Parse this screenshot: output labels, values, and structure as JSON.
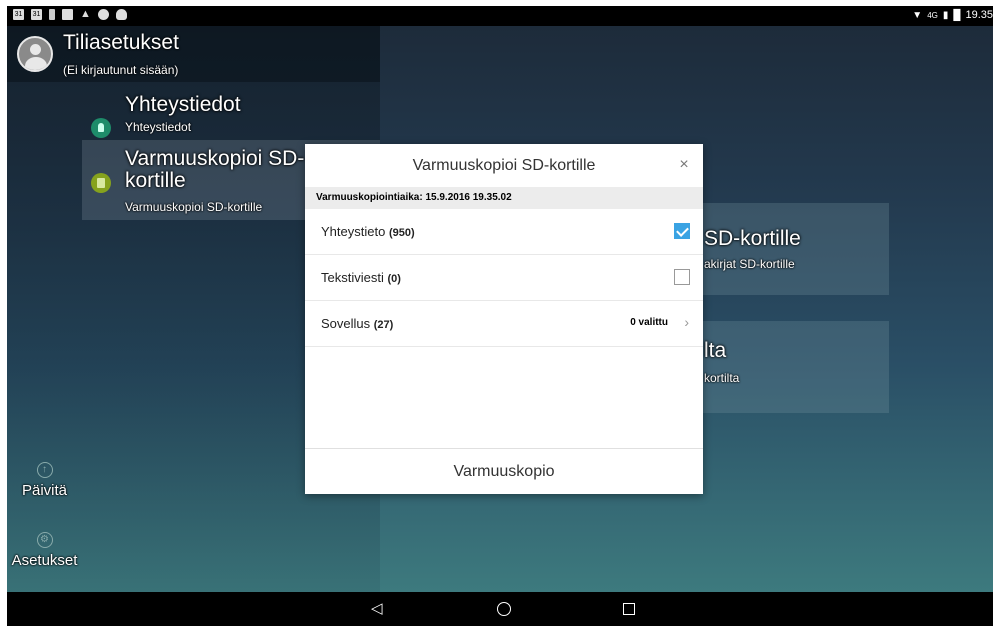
{
  "status_bar": {
    "time": "19.35",
    "network": "4G",
    "left_icons": [
      "calendar-icon",
      "calendar-icon",
      "notification-icon",
      "image-icon",
      "warning-icon",
      "globe-icon",
      "cloud-icon"
    ],
    "calendar_day": "31"
  },
  "account": {
    "title": "Tiliasetukset",
    "subtitle": "(Ei kirjautunut sisään)"
  },
  "nav": {
    "contacts": {
      "title": "Yhteystiedot",
      "subtitle": "Yhteystiedot"
    },
    "backup": {
      "title": "Varmuuskopioi SD-kortille",
      "subtitle": "Varmuuskopioi SD-kortille"
    }
  },
  "side": {
    "refresh_label": "Päivitä",
    "settings_label": "Asetukset"
  },
  "cards": {
    "card1_title": "SD-kortille",
    "card1_subtitle": "akirjat SD-kortille",
    "card2_title": "lta",
    "card2_subtitle": "kortilta"
  },
  "dialog": {
    "title": "Varmuuskopioi SD-kortille",
    "close_symbol": "×",
    "backup_time": "Varmuuskopiointiaika: 15.9.2016 19.35.02",
    "rows": [
      {
        "label": "Yhteystieto",
        "count": "(950)",
        "checked": true
      },
      {
        "label": "Tekstiviesti",
        "count": "(0)",
        "checked": false
      },
      {
        "label": "Sovellus",
        "count": "(27)",
        "selected": "0 valittu"
      }
    ],
    "action_label": "Varmuuskopio"
  },
  "colors": {
    "accent": "#3aa3e3",
    "contacts_icon": "#1e8c6a",
    "backup_icon": "#86a21d"
  }
}
